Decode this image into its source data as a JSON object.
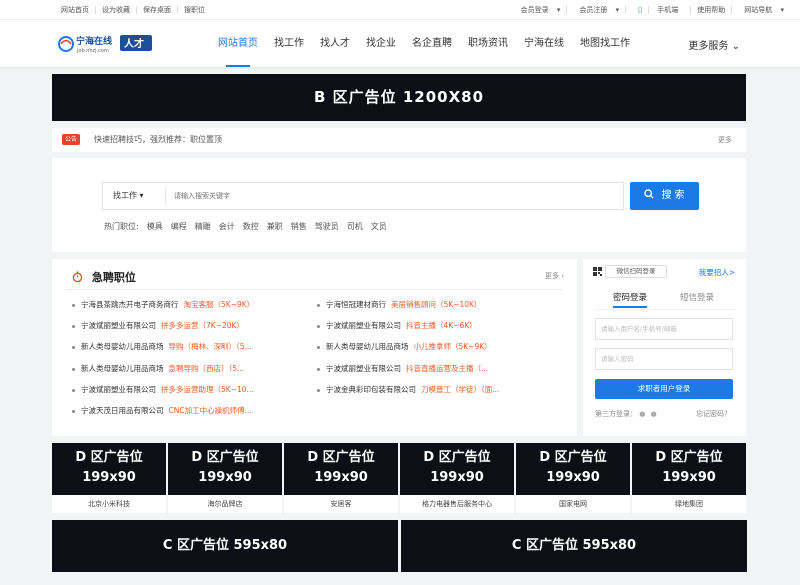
{
  "topbar": {
    "left": [
      "网站首页",
      "设为收藏",
      "保存桌面",
      "搜职位"
    ],
    "right": [
      "会员登录",
      "会员注册",
      "手机端",
      "使用帮助",
      "网站导航"
    ]
  },
  "logo": {
    "main": "宁海在线",
    "sub": "job.nhzj.com",
    "tag": "人才"
  },
  "nav": {
    "items": [
      "网站首页",
      "找工作",
      "找人才",
      "找企业",
      "名企直聘",
      "职场资讯",
      "宁海在线",
      "地图找工作"
    ],
    "more": "更多服务"
  },
  "ad_b": "B 区广告位 1200X80",
  "notice": {
    "tag": "公告",
    "text": "快速招聘技巧，强烈推荐：职位置顶",
    "more": "更多"
  },
  "search": {
    "category": "找工作",
    "placeholder": "请输入搜索关键字",
    "button": "搜 索",
    "hot_label": "热门职位:",
    "hot": [
      "模具",
      "编程",
      "精雕",
      "会计",
      "数控",
      "兼职",
      "销售",
      "驾驶员",
      "司机",
      "文员"
    ]
  },
  "jobs": {
    "title": "急聘职位",
    "more": "更多",
    "left": [
      {
        "company": "宁海县茶跳杰开电子商务商行",
        "position": "淘宝客服（5K~9K）"
      },
      {
        "company": "宁波斌丽塑业有限公司",
        "position": "拼多多运营（7K~20K）"
      },
      {
        "company": "新人类母婴幼儿用品商场",
        "position": "导购（梅林、深甽）（5..."
      },
      {
        "company": "新人类母婴幼儿用品商场",
        "position": "急聘导购（西店）（5..."
      },
      {
        "company": "宁波斌丽塑业有限公司",
        "position": "拼多多运营助理（5K~10..."
      },
      {
        "company": "宁波天茂日用品有限公司",
        "position": "CNC加工中心操机师傅..."
      }
    ],
    "right": [
      {
        "company": "宁海恒冠建材商行",
        "position": "美居销售顾问（5K~10K）"
      },
      {
        "company": "宁波斌丽塑业有限公司",
        "position": "抖音主播（4K~6K）"
      },
      {
        "company": "新人类母婴幼儿用品商场",
        "position": "小儿推拿师（5K~9K）"
      },
      {
        "company": "宁波斌丽塑业有限公司",
        "position": "抖音直播运营及主播（..."
      },
      {
        "company": "宁波金典彩印包装有限公司",
        "position": "刀模普工（学徒）（面..."
      }
    ]
  },
  "login": {
    "qr_tip": "微信扫码登录",
    "help": "我要招人>",
    "tab_password": "密码登录",
    "tab_sms": "短信登录",
    "user_placeholder": "请输入用户名/手机号/邮箱",
    "pass_placeholder": "请输入密码",
    "button": "求职者用户登录",
    "third": "第三方登录：",
    "forgot": "忘记密码？"
  },
  "ads_d": [
    {
      "line1": "D 区广告位",
      "line2": "199x90",
      "caption": "北京小米科技"
    },
    {
      "line1": "D 区广告位",
      "line2": "199x90",
      "caption": "海尔品牌店"
    },
    {
      "line1": "D 区广告位",
      "line2": "199x90",
      "caption": "安居客"
    },
    {
      "line1": "D 区广告位",
      "line2": "199x90",
      "caption": "格力电器售后服务中心"
    },
    {
      "line1": "D 区广告位",
      "line2": "199x90",
      "caption": "国家电网"
    },
    {
      "line1": "D 区广告位",
      "line2": "199x90",
      "caption": "绿地集团"
    }
  ],
  "ads_c": [
    "C 区广告位 595x80",
    "C 区广告位 595x80"
  ],
  "colors": {
    "accent": "#1b7ae6",
    "job_highlight": "#f05a24",
    "ad_bg": "#0d0f17",
    "notice_tag": "#e8412c"
  }
}
